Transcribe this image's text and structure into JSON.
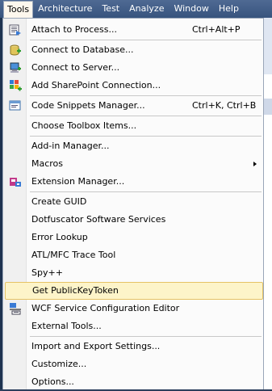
{
  "menubar": {
    "items": [
      "Tools",
      "Architecture",
      "Test",
      "Analyze",
      "Window",
      "Help"
    ],
    "active": "Tools"
  },
  "menu": {
    "items": [
      {
        "label": "Attach to Process...",
        "shortcut": "Ctrl+Alt+P",
        "icon": "attach-process-icon"
      },
      {
        "label": "Connect to Database...",
        "icon": "database-icon"
      },
      {
        "label": "Connect to Server...",
        "icon": "server-icon"
      },
      {
        "label": "Add SharePoint Connection...",
        "icon": "sharepoint-icon"
      },
      {
        "label": "Code Snippets Manager...",
        "shortcut": "Ctrl+K, Ctrl+B",
        "icon": "snippets-icon"
      },
      {
        "label": "Choose Toolbox Items..."
      },
      {
        "label": "Add-in Manager..."
      },
      {
        "label": "Macros",
        "submenu": true
      },
      {
        "label": "Extension Manager...",
        "icon": "extension-icon"
      },
      {
        "label": "Create GUID"
      },
      {
        "label": "Dotfuscator Software Services"
      },
      {
        "label": "Error Lookup"
      },
      {
        "label": "ATL/MFC Trace Tool"
      },
      {
        "label": "Spy++"
      },
      {
        "label": "Get PublicKeyToken",
        "highlighted": true
      },
      {
        "label": "WCF Service Configuration Editor",
        "icon": "wcf-icon"
      },
      {
        "label": "External Tools..."
      },
      {
        "label": "Import and Export Settings..."
      },
      {
        "label": "Customize..."
      },
      {
        "label": "Options..."
      }
    ]
  }
}
